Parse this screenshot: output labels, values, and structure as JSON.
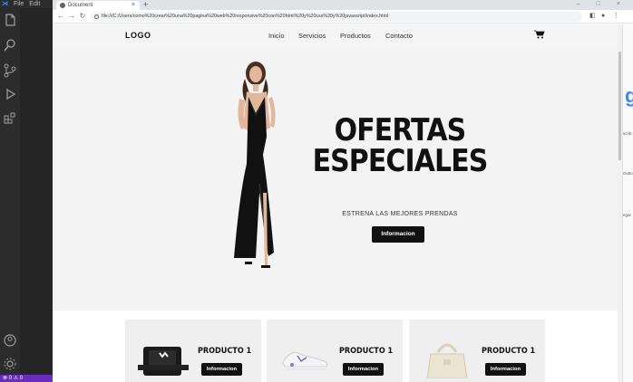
{
  "vscode": {
    "menu": [
      "File",
      "Edit"
    ],
    "status": "⊗ 0 ⚠ 0"
  },
  "browser": {
    "tab_title": "Document",
    "tab_close": "×",
    "new_tab": "+",
    "url": "file:///C:/Users/como%20crear%20una%20pagina%20web%20responsive%20con%20html%20y%20css%20y%20javascript/index.html",
    "side_texts": [
      "bia",
      "scrib",
      "Outlo",
      "egar"
    ]
  },
  "site": {
    "logo": "LOGO",
    "nav": [
      "Inicio",
      "Servicios",
      "Productos",
      "Contacto"
    ],
    "hero": {
      "title_line1": "OFERTAS",
      "title_line2": "ESPECIALES",
      "subtitle": "ESTRENA LAS MEJORES PRENDAS",
      "button": "Informacion"
    },
    "products": [
      {
        "title": "PRODUCTO 1",
        "button": "Informacion",
        "image": "belt-box"
      },
      {
        "title": "PRODUCTO 1",
        "button": "Informacion",
        "image": "sneaker"
      },
      {
        "title": "PRODUCTO 1",
        "button": "Informacion",
        "image": "tote-bag"
      }
    ]
  },
  "colors": {
    "accent_dark": "#111111",
    "hero_bg": "#f3f3f3",
    "statusbar": "#6a2bbf"
  }
}
